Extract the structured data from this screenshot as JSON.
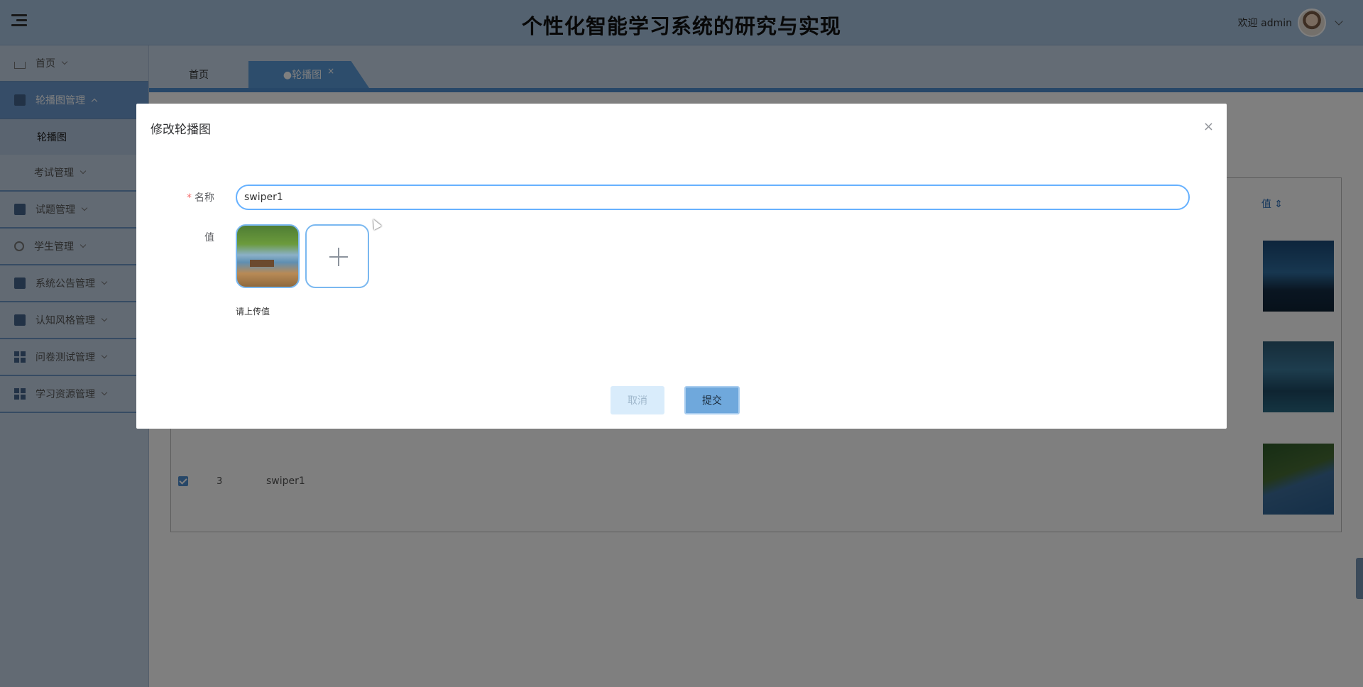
{
  "header": {
    "title": "个性化智能学习系统的研究与实现",
    "welcome": "欢迎 admin"
  },
  "sidebar": {
    "items": [
      {
        "label": "首页",
        "icon": "home-icon"
      },
      {
        "label": "轮播图管理",
        "icon": "image-icon",
        "active": true
      },
      {
        "label": "轮播图",
        "sub": true
      },
      {
        "label": "考试管理"
      },
      {
        "label": "试题管理",
        "icon": "book-icon"
      },
      {
        "label": "学生管理",
        "icon": "student-icon"
      },
      {
        "label": "系统公告管理",
        "icon": "notice-icon"
      },
      {
        "label": "认知风格管理",
        "icon": "style-icon"
      },
      {
        "label": "问卷测试管理",
        "icon": "survey-icon"
      },
      {
        "label": "学习资源管理",
        "icon": "resource-icon"
      }
    ]
  },
  "tabs": {
    "home": "首页",
    "active": "●轮播图",
    "close": "×"
  },
  "table": {
    "value_header": "值",
    "row": {
      "index": "3",
      "name": "swiper1"
    }
  },
  "dialog": {
    "title": "修改轮播图",
    "close": "×",
    "name_label": "名称",
    "name_required_mark": "*",
    "name_value": "swiper1",
    "value_label": "值",
    "upload_hint": "请上传值",
    "cancel": "取消",
    "submit": "提交"
  },
  "colors": {
    "accent": "#4f8fd0",
    "sidebar_active": "#6d9bd0",
    "required": "#f56c6c"
  }
}
